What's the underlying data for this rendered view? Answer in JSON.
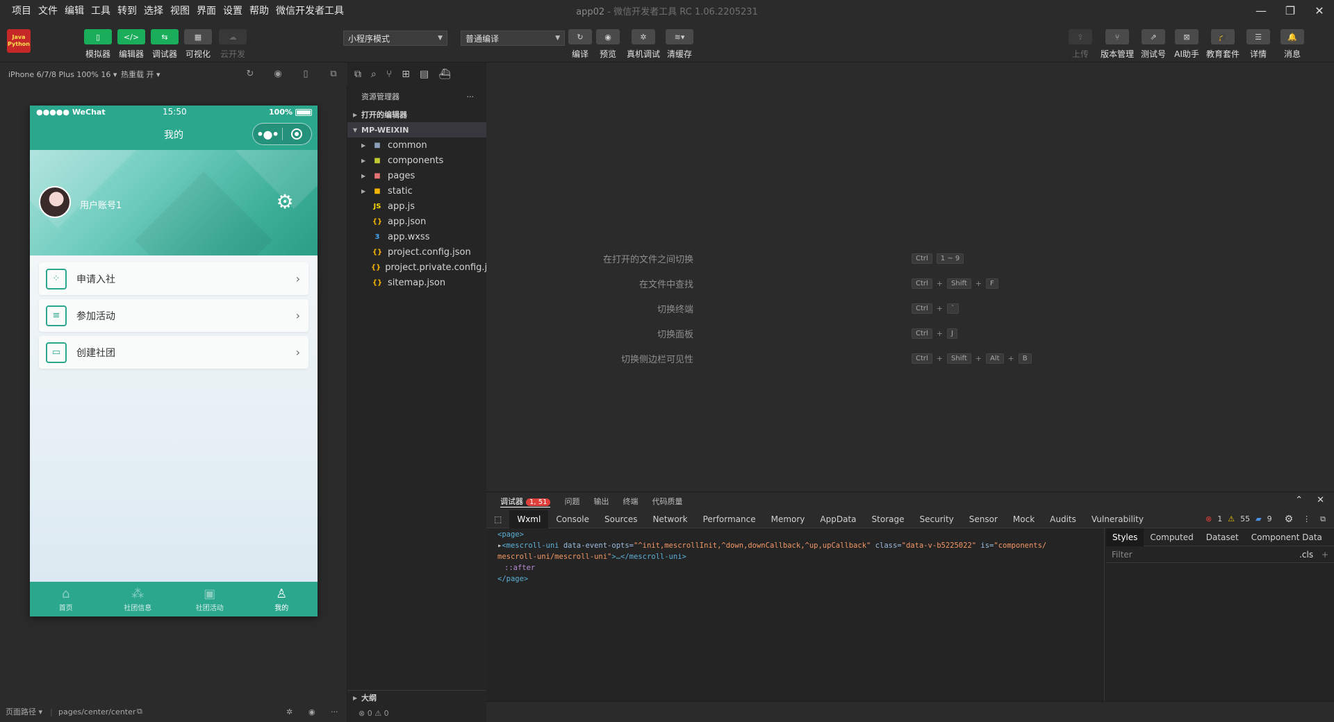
{
  "menubar": {
    "items": [
      "项目",
      "文件",
      "编辑",
      "工具",
      "转到",
      "选择",
      "视图",
      "界面",
      "设置",
      "帮助",
      "微信开发者工具"
    ],
    "title": "app02",
    "title_sub": " - 微信开发者工具 RC 1.06.2205231"
  },
  "toolbar": {
    "logo_top": "Java",
    "logo_bottom": "Python",
    "left_buttons": [
      {
        "label": "模拟器",
        "icon": "phone-icon"
      },
      {
        "label": "编辑器",
        "icon": "code-icon"
      },
      {
        "label": "调试器",
        "icon": "debug-icon"
      },
      {
        "label": "可视化",
        "icon": "layout-icon"
      },
      {
        "label": "云开发",
        "icon": "cloud-icon"
      }
    ],
    "mode_select": "小程序模式",
    "compile_select": "普通编译",
    "center_buttons": [
      {
        "label": "编译",
        "icon": "refresh-icon"
      },
      {
        "label": "预览",
        "icon": "eye-icon"
      },
      {
        "label": "真机调试",
        "icon": "bug-icon"
      },
      {
        "label": "清缓存",
        "icon": "layers-icon"
      }
    ],
    "right_buttons": [
      {
        "label": "上传",
        "icon": "upload-icon"
      },
      {
        "label": "版本管理",
        "icon": "branch-icon"
      },
      {
        "label": "测试号",
        "icon": "external-icon"
      },
      {
        "label": "AI助手",
        "icon": "ai-icon"
      },
      {
        "label": "教育套件",
        "icon": "graduation-icon"
      },
      {
        "label": "详情",
        "icon": "menu-icon"
      },
      {
        "label": "消息",
        "icon": "bell-icon"
      }
    ]
  },
  "simulator": {
    "device": "iPhone 6/7/8 Plus 100% 16",
    "hot_reload": "热重载 开",
    "status": {
      "carrier": "●●●●● WeChat",
      "time": "15:50",
      "battery": "100%"
    },
    "nav_title": "我的",
    "username": "用户账号1",
    "menu": [
      {
        "label": "申请入社",
        "icon": "grid-icon"
      },
      {
        "label": "参加活动",
        "icon": "list-icon"
      },
      {
        "label": "创建社团",
        "icon": "card-icon"
      }
    ],
    "tabs": [
      {
        "label": "首页",
        "icon": "home-icon",
        "active": false
      },
      {
        "label": "社团信息",
        "icon": "clubs-icon",
        "active": false
      },
      {
        "label": "社团活动",
        "icon": "activity-icon",
        "active": false
      },
      {
        "label": "我的",
        "icon": "user-icon",
        "active": true
      }
    ],
    "footer_path_label": "页面路径",
    "footer_path": "pages/center/center"
  },
  "explorer": {
    "title": "资源管理器",
    "open_editors": "打开的编辑器",
    "project": "MP-WEIXIN",
    "folders": [
      "common",
      "components",
      "pages",
      "static"
    ],
    "files": [
      {
        "name": "app.js",
        "type": "js"
      },
      {
        "name": "app.json",
        "type": "json"
      },
      {
        "name": "app.wxss",
        "type": "css"
      },
      {
        "name": "project.config.json",
        "type": "json"
      },
      {
        "name": "project.private.config.js...",
        "type": "json"
      },
      {
        "name": "sitemap.json",
        "type": "json"
      }
    ],
    "outline": "大纲",
    "footer": "⊗ 0 ⚠ 0"
  },
  "editor": {
    "shortcuts": [
      {
        "label": "在打开的文件之间切换",
        "keys": [
          "Ctrl",
          "1 ~ 9"
        ]
      },
      {
        "label": "在文件中查找",
        "keys": [
          "Ctrl",
          "Shift",
          "F"
        ]
      },
      {
        "label": "切换终端",
        "keys": [
          "Ctrl",
          "`"
        ]
      },
      {
        "label": "切换面板",
        "keys": [
          "Ctrl",
          "J"
        ]
      },
      {
        "label": "切换侧边栏可见性",
        "keys": [
          "Ctrl",
          "Shift",
          "Alt",
          "B"
        ]
      }
    ]
  },
  "debugger": {
    "tabs": [
      "调试器",
      "问题",
      "输出",
      "终端",
      "代码质量"
    ],
    "badge": "1, 51",
    "console_tabs": [
      "Wxml",
      "Console",
      "Sources",
      "Network",
      "Performance",
      "Memory",
      "AppData",
      "Storage",
      "Security",
      "Sensor",
      "Mock",
      "Audits",
      "Vulnerability"
    ],
    "errors": "1",
    "warnings": "55",
    "infos": "9",
    "code": {
      "open_page": "<page>",
      "mescroll_tag": "<mescroll-uni",
      "attr1": " data-event-opts=",
      "val1": "\"^init,mescrollInit,^down,downCallback,^up,upCallback\"",
      "attr2": " class=",
      "val2": "\"data-v-b5225022\"",
      "attr3": " is=",
      "val3": "\"components/",
      "val3b": "mescroll-uni/mescroll-uni\"",
      "close_mescroll": ">…</mescroll-uni>",
      "after": "::after",
      "close_page": "</page>"
    },
    "style_tabs": [
      "Styles",
      "Computed",
      "Dataset",
      "Component Data"
    ],
    "filter_placeholder": "Filter",
    "cls": ".cls"
  }
}
